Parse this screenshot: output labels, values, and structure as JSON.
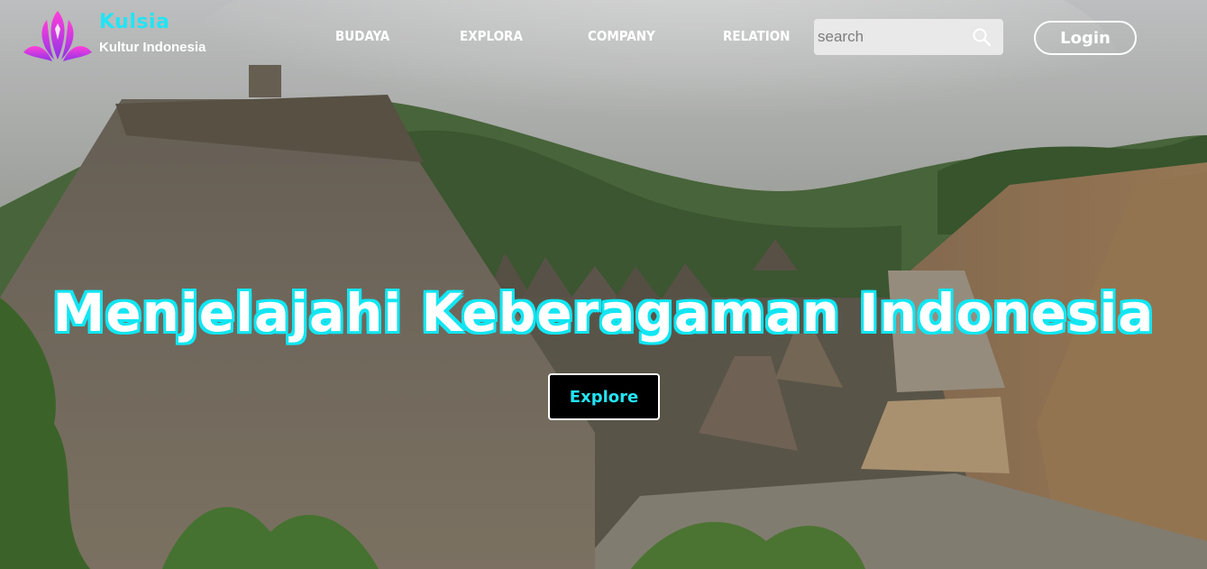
{
  "brand": {
    "name": "Kulsia",
    "tagline": "Kultur Indonesia",
    "logo_icon": "feather-crown-icon"
  },
  "nav": {
    "items": [
      {
        "label": "BUDAYA"
      },
      {
        "label": "EXPLORA"
      },
      {
        "label": "COMPANY"
      },
      {
        "label": "RELATION"
      }
    ]
  },
  "search": {
    "placeholder": "search",
    "value": "",
    "icon": "search-icon"
  },
  "header": {
    "login_label": "Login"
  },
  "hero": {
    "title": "Menjelajahi Keberagaman Indonesia",
    "button_label": "Explore"
  },
  "colors": {
    "accent": "#22e4f5",
    "logo_gradient": [
      "#ff2fd6",
      "#8a2be2"
    ],
    "search_bg": "#e9e9e9",
    "button_bg": "#000000"
  }
}
